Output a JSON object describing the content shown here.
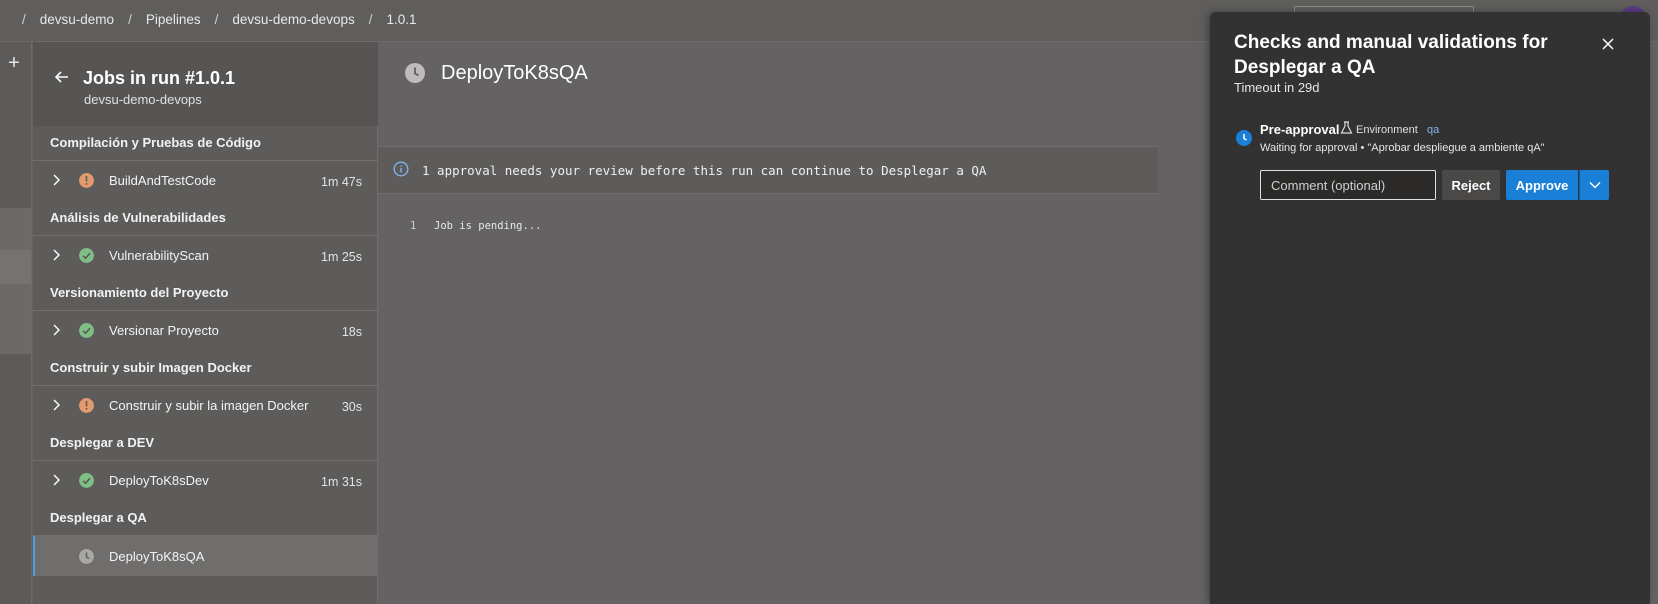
{
  "breadcrumb": {
    "items": [
      "devsu-demo",
      "Pipelines",
      "devsu-demo-devops",
      "1.0.1"
    ],
    "separator": "/"
  },
  "rail": {
    "add_label": "+"
  },
  "jobs_panel": {
    "title": "Jobs in run #1.0.1",
    "subtitle": "devsu-demo-devops",
    "stages": [
      {
        "title": "Compilación y Pruebas de Código",
        "job": {
          "name": "BuildAndTestCode",
          "duration": "1m 47s",
          "status": "warning"
        }
      },
      {
        "title": "Análisis de Vulnerabilidades",
        "job": {
          "name": "VulnerabilityScan",
          "duration": "1m 25s",
          "status": "success"
        }
      },
      {
        "title": "Versionamiento del Proyecto",
        "job": {
          "name": "Versionar Proyecto",
          "duration": "18s",
          "status": "success"
        }
      },
      {
        "title": "Construir y subir Imagen Docker",
        "job": {
          "name": "Construir y subir la imagen Docker",
          "duration": "30s",
          "status": "warning"
        }
      },
      {
        "title": "Desplegar a DEV",
        "job": {
          "name": "DeployToK8sDev",
          "duration": "1m 31s",
          "status": "success"
        }
      },
      {
        "title": "Desplegar a QA",
        "job": {
          "name": "DeployToK8sQA",
          "duration": "",
          "status": "pending"
        }
      }
    ]
  },
  "main": {
    "job_title": "DeployToK8sQA",
    "banner": "1 approval needs your review before this run can continue to Desplegar a QA",
    "log": [
      {
        "line": "1",
        "text": "Job is pending..."
      }
    ]
  },
  "approval_panel": {
    "title": "Checks and manual validations for Desplegar a QA",
    "timeout": "Timeout in 29d",
    "check_name": "Pre-approval",
    "environment_label": "Environment",
    "environment_name": "qa",
    "waiting_text": "Waiting for approval • \"Aprobar despliegue a ambiente qA\"",
    "comment_placeholder": "Comment (optional)",
    "reject_label": "Reject",
    "approve_label": "Approve"
  },
  "colors": {
    "success": "#7fbf86",
    "warning": "#e39a6c",
    "pending": "#a9a8a7",
    "accent": "#1a7fd6",
    "link": "#7fb3ee"
  },
  "icons": [
    "back-arrow-icon",
    "chevron-right-icon",
    "success-check-icon",
    "warning-icon",
    "clock-icon",
    "info-icon",
    "close-icon",
    "environment-icon",
    "chevron-down-icon"
  ]
}
